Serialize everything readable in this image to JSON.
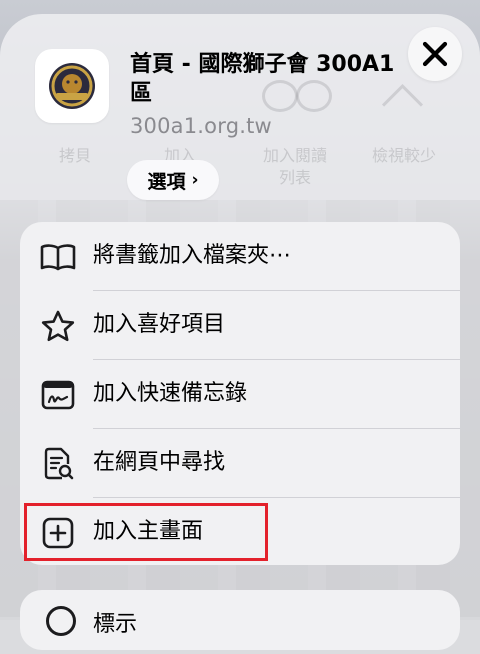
{
  "site": {
    "title": "首頁 - 國際獅子會 300A1區",
    "url": "300a1.org.tw"
  },
  "options": {
    "label": "選項",
    "chevron": "›"
  },
  "close": {
    "icon": "close-icon"
  },
  "background_toolbar": [
    {
      "label": "拷貝"
    },
    {
      "label": "加入"
    },
    {
      "label": "加入閱讀\n列表"
    },
    {
      "label": "檢視較少"
    }
  ],
  "menu": {
    "items": [
      {
        "label": "將書籤加入檔案夾⋯",
        "icon": "book-icon"
      },
      {
        "label": "加入喜好項目",
        "icon": "star-icon"
      },
      {
        "label": "加入快速備忘錄",
        "icon": "quick-note-icon"
      },
      {
        "label": "在網頁中尋找",
        "icon": "find-in-page-icon"
      },
      {
        "label": "加入主畫面",
        "icon": "add-square-icon"
      }
    ]
  },
  "next_item": {
    "label": "標示",
    "icon": "circle-icon"
  },
  "colors": {
    "highlight": "#e3212b",
    "sheet": "#f0f0f3",
    "secondary_text": "#8a8a8f"
  }
}
